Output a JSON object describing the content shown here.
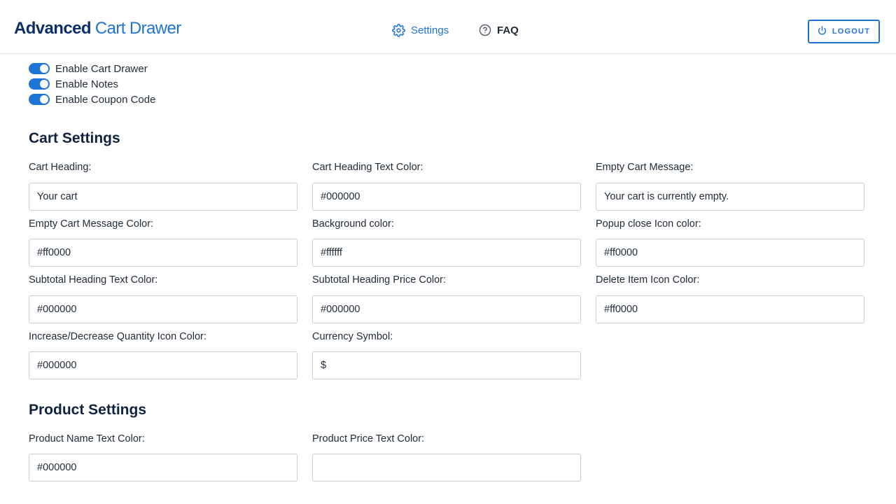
{
  "header": {
    "brand_bold": "Advanced",
    "brand_light": "Cart Drawer",
    "nav": {
      "settings": "Settings",
      "faq": "FAQ"
    },
    "logout": "LOGOUT"
  },
  "toggles": [
    {
      "label": "Enable Cart Drawer",
      "on": true
    },
    {
      "label": "Enable Notes",
      "on": true
    },
    {
      "label": "Enable Coupon Code",
      "on": true
    }
  ],
  "cart_settings": {
    "title": "Cart Settings",
    "fields": [
      {
        "label": "Cart Heading:",
        "value": "Your cart"
      },
      {
        "label": "Cart Heading Text Color:",
        "value": "#000000"
      },
      {
        "label": "Empty Cart Message:",
        "value": "Your cart is currently empty."
      },
      {
        "label": "Empty Cart Message Color:",
        "value": "#ff0000"
      },
      {
        "label": "Background color:",
        "value": "#ffffff"
      },
      {
        "label": "Popup close Icon color:",
        "value": "#ff0000"
      },
      {
        "label": "Subtotal Heading Text Color:",
        "value": "#000000"
      },
      {
        "label": "Subtotal Heading Price Color:",
        "value": "#000000"
      },
      {
        "label": "Delete Item Icon Color:",
        "value": "#ff0000"
      },
      {
        "label": "Increase/Decrease Quantity Icon Color:",
        "value": "#000000"
      },
      {
        "label": "Currency Symbol:",
        "value": "$"
      }
    ]
  },
  "product_settings": {
    "title": "Product Settings",
    "fields": [
      {
        "label": "Product Name Text Color:",
        "value": "#000000"
      },
      {
        "label": "Product Price Text Color:",
        "value": ""
      }
    ]
  },
  "colors": {
    "accent": "#1f73d6",
    "brand_dark": "#0b2f6b"
  },
  "icons": {
    "settings": "gear-icon",
    "faq": "question-circle-icon",
    "logout": "power-icon"
  }
}
